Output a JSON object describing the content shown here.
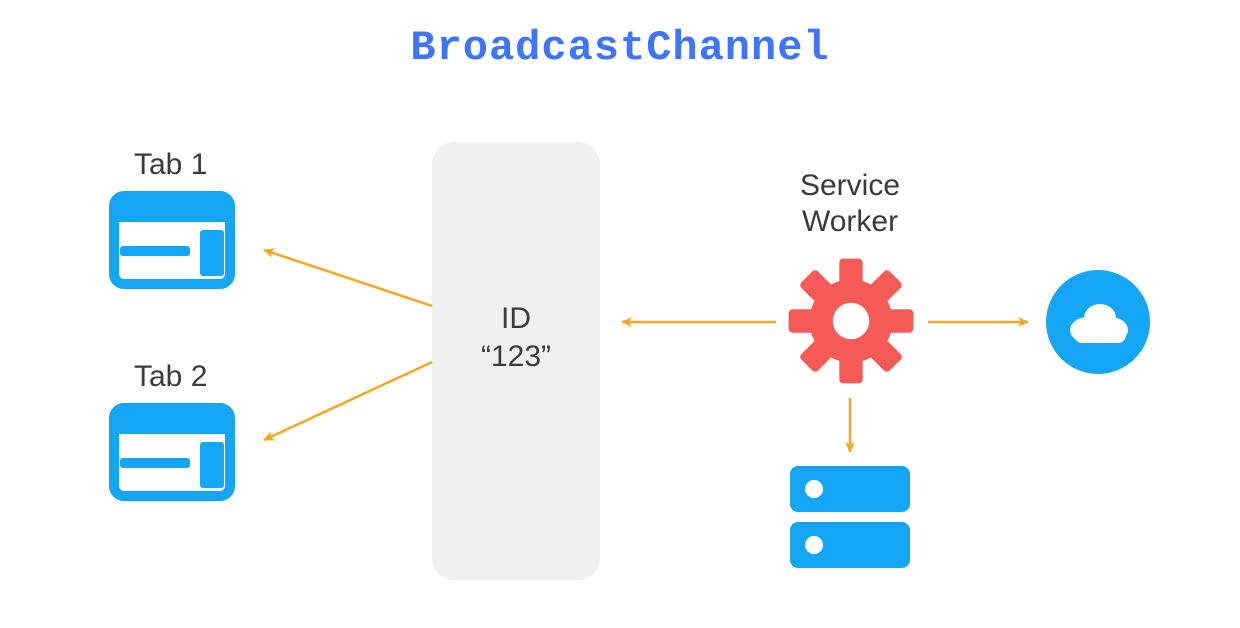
{
  "title": "BroadcastChannel",
  "tabs": {
    "tab1": "Tab 1",
    "tab2": "Tab 2"
  },
  "channel": {
    "line1": "ID",
    "line2": "“123”"
  },
  "service_worker": {
    "line1": "Service",
    "line2": "Worker"
  },
  "icons": {
    "tab1": "browser-tab-icon",
    "tab2": "browser-tab-icon",
    "gear": "gear-icon",
    "cloud": "cloud-icon",
    "storage": "storage-icon"
  },
  "colors": {
    "title": "#3e74ff",
    "accent": "#14a6f3",
    "gear": "#f45b56",
    "arrow": "#f6a623",
    "channel_bg": "#f0f0f0"
  }
}
